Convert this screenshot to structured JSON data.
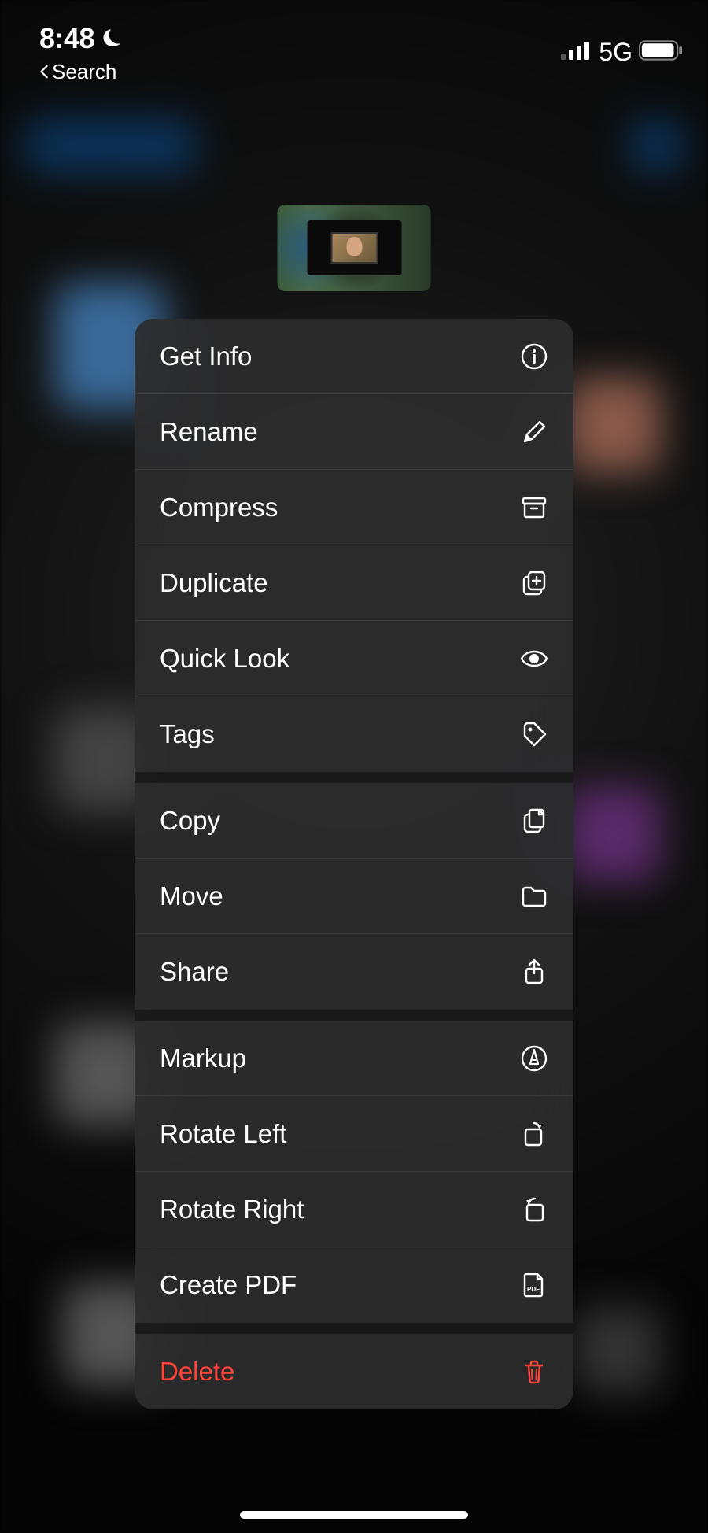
{
  "status_bar": {
    "time": "8:48",
    "breadcrumb_label": "Search",
    "network_label": "5G"
  },
  "context_menu": {
    "groups": [
      [
        {
          "label": "Get Info",
          "icon": "info-icon",
          "destructive": false
        },
        {
          "label": "Rename",
          "icon": "pencil-icon",
          "destructive": false
        },
        {
          "label": "Compress",
          "icon": "archive-icon",
          "destructive": false
        },
        {
          "label": "Duplicate",
          "icon": "duplicate-icon",
          "destructive": false
        },
        {
          "label": "Quick Look",
          "icon": "eye-icon",
          "destructive": false
        },
        {
          "label": "Tags",
          "icon": "tag-icon",
          "destructive": false
        }
      ],
      [
        {
          "label": "Copy",
          "icon": "copy-icon",
          "destructive": false
        },
        {
          "label": "Move",
          "icon": "folder-icon",
          "destructive": false
        },
        {
          "label": "Share",
          "icon": "share-icon",
          "destructive": false
        }
      ],
      [
        {
          "label": "Markup",
          "icon": "markup-icon",
          "destructive": false
        },
        {
          "label": "Rotate Left",
          "icon": "rotate-left-icon",
          "destructive": false
        },
        {
          "label": "Rotate Right",
          "icon": "rotate-right-icon",
          "destructive": false
        },
        {
          "label": "Create PDF",
          "icon": "pdf-icon",
          "destructive": false
        }
      ],
      [
        {
          "label": "Delete",
          "icon": "trash-icon",
          "destructive": true
        }
      ]
    ]
  },
  "colors": {
    "destructive": "#ff453a",
    "menu_bg": "rgba(44,44,46,0.92)",
    "separator": "rgba(120,120,128,0.20)"
  }
}
